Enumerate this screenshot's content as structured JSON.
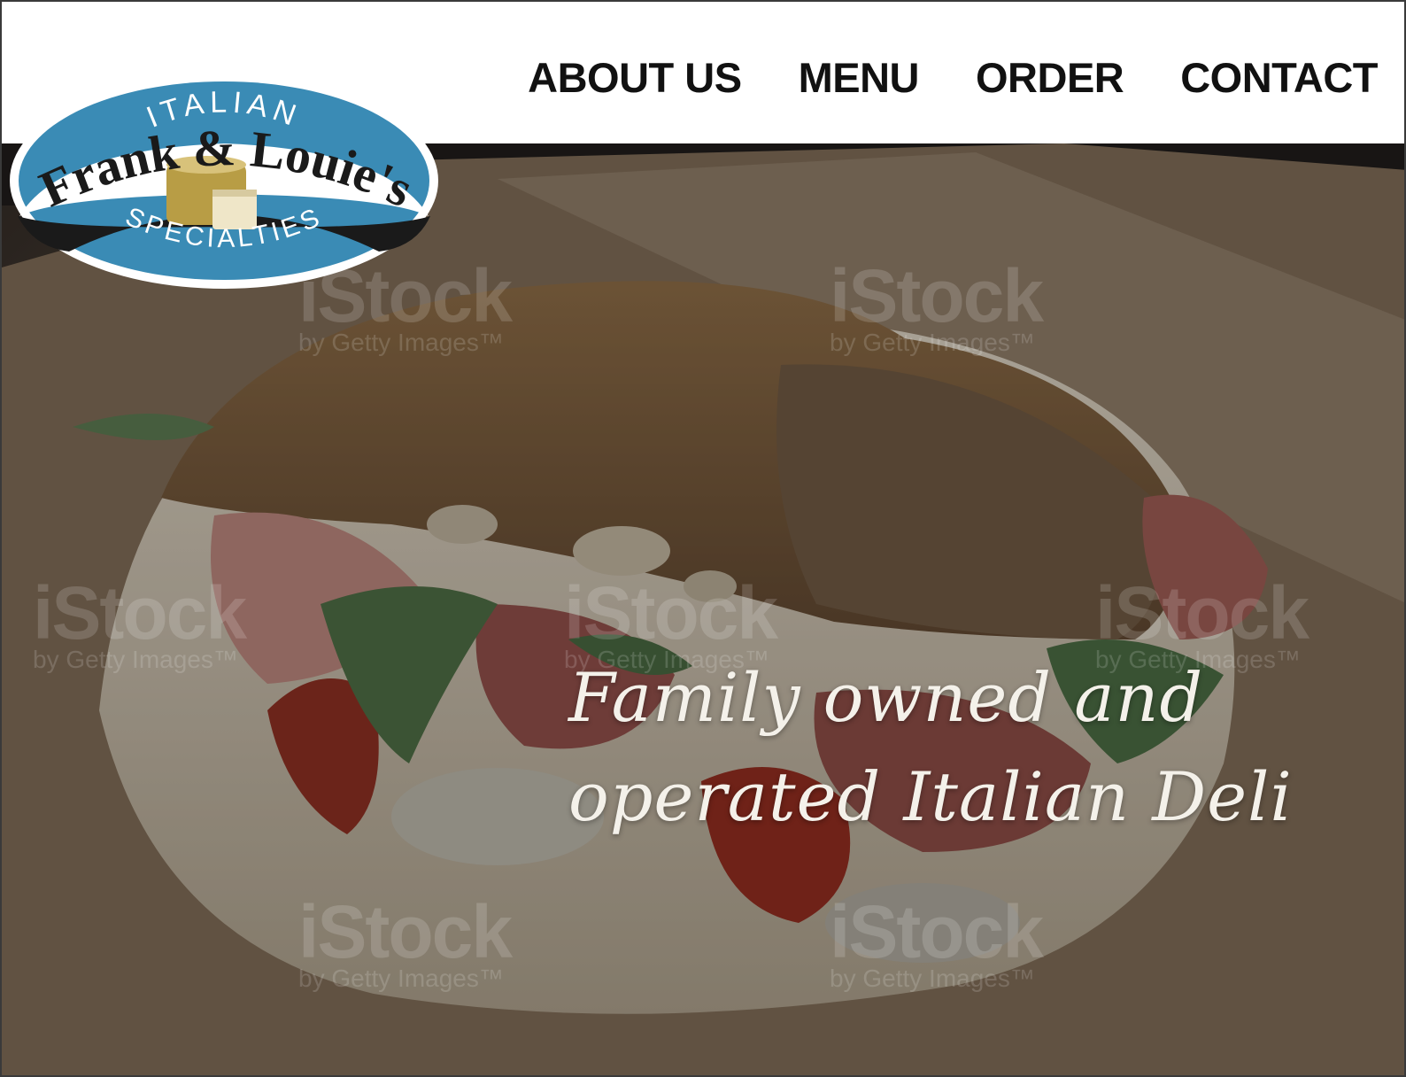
{
  "nav": {
    "items": [
      {
        "label": "ABOUT US"
      },
      {
        "label": "MENU"
      },
      {
        "label": "ORDER"
      },
      {
        "label": "CONTACT"
      }
    ]
  },
  "logo": {
    "top_text": "ITALIAN",
    "name": "Frank & Louie's",
    "bottom_text": "SPECIALTIES"
  },
  "hero": {
    "tagline_line1": "Family owned and",
    "tagline_line2": "operated Italian Deli",
    "watermark_brand": "iStock",
    "watermark_sub": "by Getty Images™"
  },
  "colors": {
    "logo_blue": "#3a8bb5",
    "logo_black": "#1a1a1a",
    "nav_text": "#111111",
    "tagline": "#f4f1ea"
  }
}
